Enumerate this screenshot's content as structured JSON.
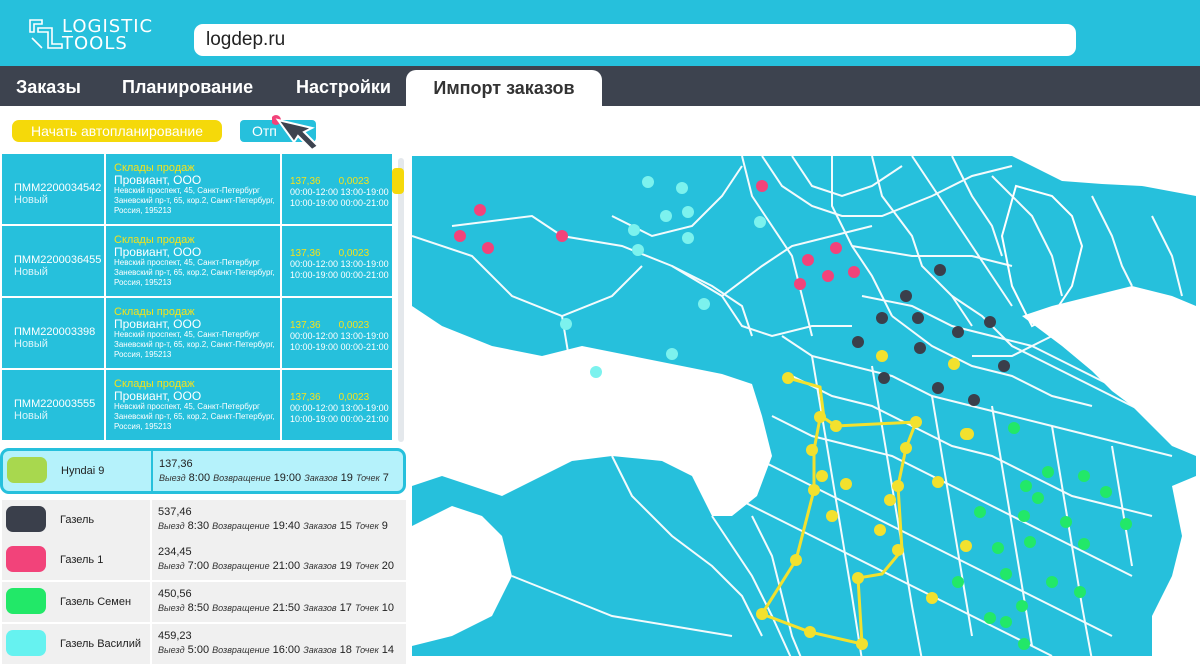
{
  "app": {
    "logo_line1": "LOGISTIC",
    "logo_line2": "TOOLS",
    "url": "logdep.ru"
  },
  "nav": {
    "tabs": [
      {
        "label": "Заказы"
      },
      {
        "label": "Планирование"
      },
      {
        "label": "Настройки"
      },
      {
        "label": "Импорт заказов"
      }
    ],
    "active_tab": "Импорт заказов"
  },
  "toolbar": {
    "auto_plan_label": "Начать автопланирование",
    "send_label": "Отп"
  },
  "orders": [
    {
      "id": "ПММ2200034542",
      "status": "Новый",
      "category": "Склады продаж",
      "company": "Провиант, ООО",
      "address": "Невский проспект, 45, Санкт-Петербург Заневский пр-т, 65, кор.2, Санкт-Петербург, Россия, 195213",
      "sum": "137,36",
      "weight": "0,0023",
      "time1": "00:00-12:00 13:00-19:00",
      "time2": "10:00-19:00 00:00-21:00"
    },
    {
      "id": "ПММ2200036455",
      "status": "Новый",
      "category": "Склады продаж",
      "company": "Провиант, ООО",
      "address": "Невский проспект, 45, Санкт-Петербург Заневский пр-т, 65, кор.2, Санкт-Петербург, Россия, 195213",
      "sum": "137,36",
      "weight": "0,0023",
      "time1": "00:00-12:00 13:00-19:00",
      "time2": "10:00-19:00 00:00-21:00"
    },
    {
      "id": "ПММ220003398",
      "status": "Новый",
      "category": "Склады продаж",
      "company": "Провиант, ООО",
      "address": "Невский проспект, 45, Санкт-Петербург Заневский пр-т, 65, кор.2, Санкт-Петербург, Россия, 195213",
      "sum": "137,36",
      "weight": "0,0023",
      "time1": "00:00-12:00 13:00-19:00",
      "time2": "10:00-19:00 00:00-21:00"
    },
    {
      "id": "ПММ220003555",
      "status": "Новый",
      "category": "Склады продаж",
      "company": "Провиант, ООО",
      "address": "Невский проспект, 45, Санкт-Петербург Заневский пр-т, 65, кор.2, Санкт-Петербург, Россия, 195213",
      "sum": "137,36",
      "weight": "0,0023",
      "time1": "00:00-12:00 13:00-19:00",
      "time2": "10:00-19:00 00:00-21:00"
    }
  ],
  "vehicle_labels": {
    "depart": "Выезд",
    "return": "Возвращение",
    "orders": "Заказов",
    "points": "Точек"
  },
  "vehicles": [
    {
      "name": "Hyndai 9",
      "color": "#a8d84e",
      "sum": "137,36",
      "depart": "8:00",
      "return": "19:00",
      "orders": "19",
      "points": "7",
      "selected": true
    },
    {
      "name": "Газель",
      "color": "#3a3f4b",
      "sum": "537,46",
      "depart": "8:30",
      "return": "19:40",
      "orders": "15",
      "points": "9",
      "selected": false
    },
    {
      "name": "Газель 1",
      "color": "#f2437a",
      "sum": "234,45",
      "depart": "7:00",
      "return": "21:00",
      "orders": "19",
      "points": "20",
      "selected": false
    },
    {
      "name": "Газель Семен",
      "color": "#22e868",
      "sum": "450,56",
      "depart": "8:50",
      "return": "21:50",
      "orders": "17",
      "points": "10",
      "selected": false
    },
    {
      "name": "Газель Василий",
      "color": "#66f2f0",
      "sum": "459,23",
      "depart": "5:00",
      "return": "16:00",
      "orders": "18",
      "points": "14",
      "selected": false
    }
  ],
  "colors": {
    "accent": "#26c0dc",
    "nav": "#3d434f",
    "yellow": "#f5d90a",
    "route": "#f2e12e",
    "dark_points": "#3a3f4b",
    "pink_points": "#f2437a",
    "green_points": "#22e868",
    "cyan_points": "#7cf2ee"
  }
}
